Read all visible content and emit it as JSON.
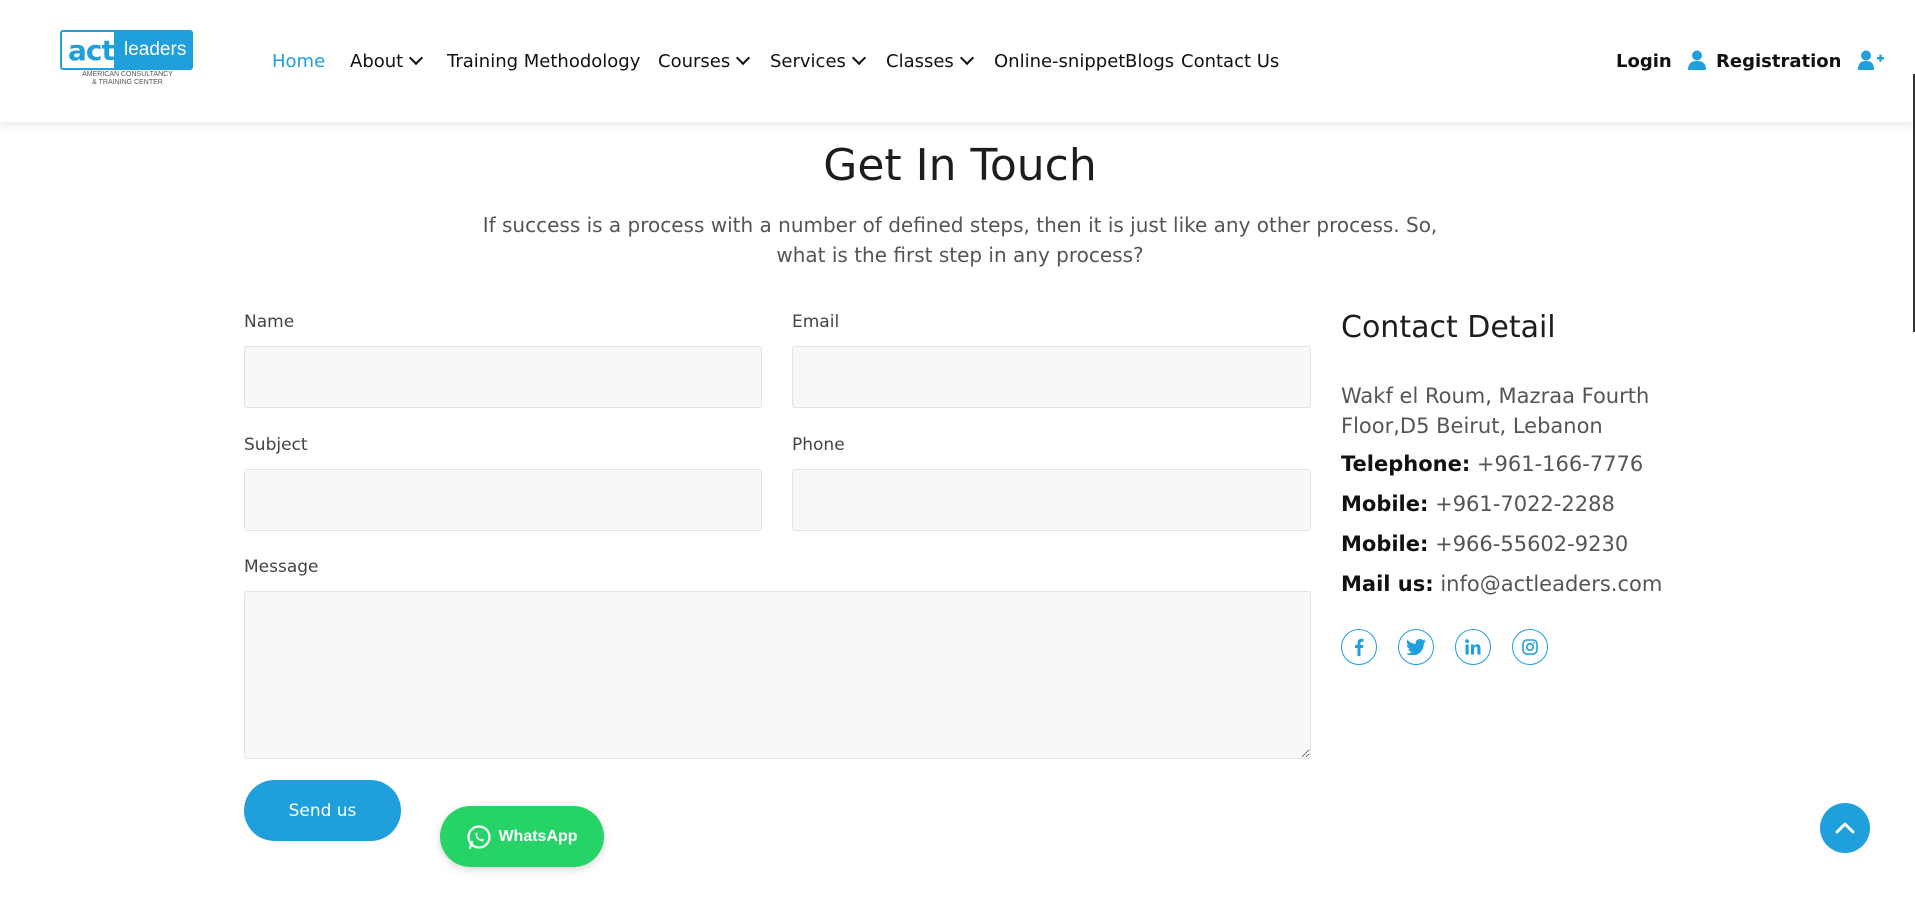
{
  "header": {
    "logo": {
      "act": "act",
      "leaders": "leaders",
      "sub_line1": "AMERICAN CONSULTANCY",
      "sub_line2": "& TRAINING CENTER"
    },
    "nav": [
      {
        "label": "Home",
        "active": true
      },
      {
        "label": "About",
        "dropdown": true
      },
      {
        "label": "Training Methodology"
      },
      {
        "label": "Courses",
        "dropdown": true
      },
      {
        "label": "Services",
        "dropdown": true
      },
      {
        "label": "Classes",
        "dropdown": true
      },
      {
        "label": "Online-snippet"
      },
      {
        "label": "Blogs"
      },
      {
        "label": "Contact Us"
      }
    ],
    "login_label": "Login",
    "registration_label": "Registration",
    "icons": {
      "login": "user-icon",
      "registration": "user-plus-icon"
    }
  },
  "page": {
    "title": "Get In Touch",
    "subtitle": "If success is a process with a number of defined steps, then it is just like any other process. So, what is the first step in any process?"
  },
  "form": {
    "name_label": "Name",
    "name_value": "",
    "email_label": "Email",
    "email_value": "",
    "subject_label": "Subject",
    "subject_value": "",
    "phone_label": "Phone",
    "phone_value": "",
    "message_label": "Message",
    "message_value": "",
    "send_label": "Send us"
  },
  "contact": {
    "title": "Contact Detail",
    "address": "Wakf el Roum, Mazraa Fourth Floor,D5 Beirut, Lebanon",
    "telephone_label": "Telephone:",
    "telephone": "+961-166-7776",
    "mobile1_label": "Mobile:",
    "mobile1": "+961-7022-2288",
    "mobile2_label": "Mobile:",
    "mobile2": "+966-55602-9230",
    "mail_label": "Mail us:",
    "mail": "info@actleaders.com",
    "social_icons": [
      "facebook-icon",
      "twitter-icon",
      "linkedin-icon",
      "instagram-icon"
    ]
  },
  "whatsapp": {
    "label": "WhatsApp",
    "icon": "whatsapp-icon"
  },
  "scroll_top": {
    "icon": "chevron-up-icon"
  },
  "colors": {
    "accent": "#1f9fdc",
    "whatsapp": "#25d366",
    "field_bg": "#f8f8f8"
  }
}
